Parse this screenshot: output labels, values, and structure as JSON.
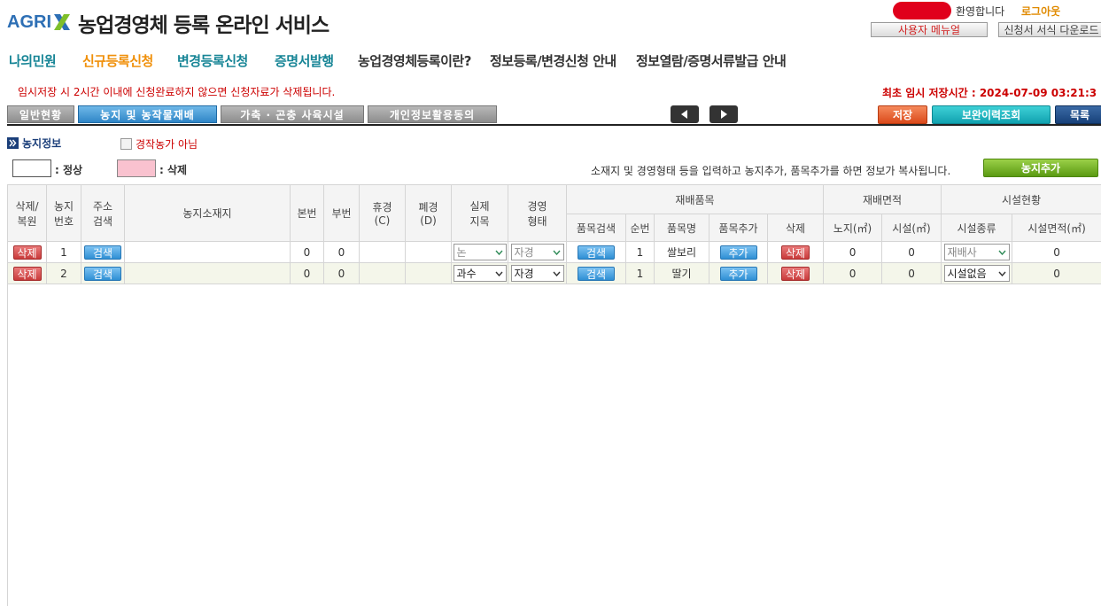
{
  "header": {
    "logo_text": "AGRI",
    "site_title": "농업경영체 등록 온라인 서비스",
    "welcome": "환영합니다",
    "logout": "로그아웃",
    "user_manual": "사용자 메뉴얼",
    "form_download": "신청서 서식 다운로드"
  },
  "nav": [
    "나의민원",
    "신규등록신청",
    "변경등록신청",
    "증명서발행",
    "농업경영체등록이란?",
    "정보등록/변경신청 안내",
    "정보열람/증명서류발급 안내"
  ],
  "notice": "임시저장 시 2시간 이내에 신청완료하지 않으면 신청자료가 삭제됩니다.",
  "save_time": "최초 임시 저장시간 : 2024-07-09 03:21:3",
  "tabs": [
    "일반현황",
    "농지 및 농작물재배",
    "가축 · 곤충 사육시설",
    "개인정보활용동의"
  ],
  "actions": {
    "save": "저장",
    "history": "보완이력조회",
    "list": "목록"
  },
  "section": {
    "title": "농지정보",
    "checkbox_label": "경작농가 아님"
  },
  "legend": {
    "normal": ": 정상",
    "delete": ": 삭제"
  },
  "copy_hint": "소재지 및 경영형태 등을 입력하고 농지추가, 품목추가를 하면 정보가 복사됩니다.",
  "add_farm": "농지추가",
  "table": {
    "headers": {
      "delete_restore": "삭제/\n복원",
      "farm_no": "농지\n번호",
      "addr_search": "주소\n검색",
      "location": "농지소재지",
      "main_no": "본번",
      "sub_no": "부번",
      "fallow": "휴경\n(C)",
      "abandon": "폐경\n(D)",
      "land_category": "실제\n지목",
      "mgmt_type": "경영\n형태",
      "crop_group": "재배품목",
      "area_group": "재배면적",
      "facility_group": "시설현황",
      "crop_search": "품목검색",
      "seq": "순번",
      "crop_name": "품목명",
      "crop_add": "품목추가",
      "crop_delete": "삭제",
      "open_area": "노지(㎡)",
      "facility_area_cult": "시설(㎡)",
      "facility_type": "시설종류",
      "facility_area": "시설면적(㎡)"
    },
    "rows": [
      {
        "delete": "삭제",
        "no": "1",
        "search": "검색",
        "location": "",
        "main_no": "0",
        "sub_no": "0",
        "fallow": "",
        "abandon": "",
        "land_category": "논",
        "mgmt_type": "자경",
        "crop_search": "검색",
        "seq": "1",
        "crop_name": "쌀보리",
        "crop_add": "추가",
        "crop_delete": "삭제",
        "open_area": "0",
        "facility_area_cult": "0",
        "facility_type": "재배사",
        "facility_area": "0"
      },
      {
        "delete": "삭제",
        "no": "2",
        "search": "검색",
        "location": "",
        "main_no": "0",
        "sub_no": "0",
        "fallow": "",
        "abandon": "",
        "land_category": "과수",
        "mgmt_type": "자경",
        "crop_search": "검색",
        "seq": "1",
        "crop_name": "딸기",
        "crop_add": "추가",
        "crop_delete": "삭제",
        "open_area": "0",
        "facility_area_cult": "0",
        "facility_type": "시설없음",
        "facility_area": "0"
      }
    ]
  },
  "colors": {
    "accent_teal": "#178596",
    "accent_orange": "#f0900a",
    "alert_red": "#cc0000"
  }
}
